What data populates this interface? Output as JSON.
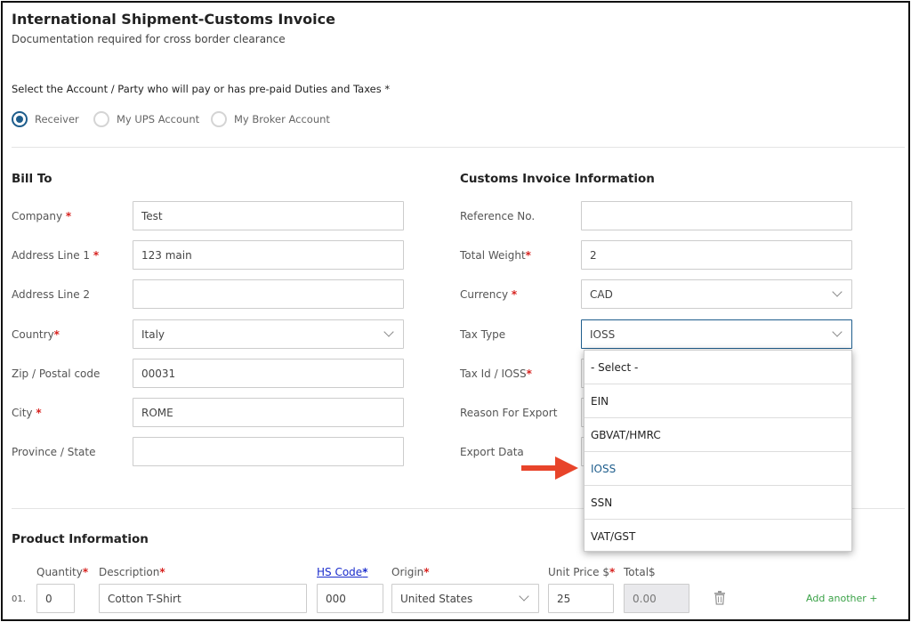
{
  "header": {
    "title": "International Shipment-Customs Invoice",
    "subtitle": "Documentation required for cross border clearance"
  },
  "payer": {
    "label": "Select the Account / Party who will pay or has pre-paid Duties and Taxes *",
    "options": [
      "Receiver",
      "My UPS Account",
      "My Broker Account"
    ],
    "selected": "Receiver"
  },
  "bill_to": {
    "title": "Bill To",
    "fields": [
      {
        "label": "Company",
        "required": "*",
        "value": "Test"
      },
      {
        "label": "Address Line 1",
        "required": "*",
        "value": "123 main"
      },
      {
        "label": "Address Line 2",
        "required": "",
        "value": ""
      },
      {
        "label": "Country",
        "required": "*",
        "value": "Italy"
      },
      {
        "label": "Zip / Postal code",
        "required": "",
        "value": "00031"
      },
      {
        "label": "City",
        "required": "*",
        "value": "ROME"
      },
      {
        "label": "Province / State",
        "required": "",
        "value": ""
      }
    ]
  },
  "customs": {
    "title": "Customs Invoice Information",
    "fields": [
      {
        "label": "Reference No.",
        "required": "",
        "value": ""
      },
      {
        "label": "Total Weight",
        "required": "*",
        "value": "2"
      },
      {
        "label": "Currency",
        "required": "*",
        "value": "CAD"
      },
      {
        "label": "Tax Type",
        "required": "",
        "value": "IOSS"
      },
      {
        "label": "Tax Id / IOSS",
        "required": "*",
        "value": ""
      },
      {
        "label": "Reason For Export",
        "required": "",
        "value": ""
      },
      {
        "label": "Export Data",
        "required": "",
        "value": ""
      }
    ]
  },
  "tax_type_dropdown": {
    "options": [
      "- Select -",
      "EIN",
      "GBVAT/HMRC",
      "IOSS",
      "SSN",
      "VAT/GST"
    ],
    "selected": "IOSS"
  },
  "product": {
    "title": "Product Information",
    "columns": {
      "quantity": "Quantity",
      "description": "Description",
      "hs_code": "HS Code",
      "origin": "Origin",
      "unit_price": "Unit Price $",
      "total": "Total$"
    },
    "rows": [
      {
        "num": "01.",
        "quantity": "0",
        "description": "Cotton T-Shirt",
        "hs_code": "000",
        "origin": "United States",
        "unit_price": "25",
        "total": "0.00"
      }
    ],
    "add_another": "Add another +"
  },
  "colors": {
    "accent": "#1e5d8c",
    "required": "#d7221f",
    "arrow": "#e8442a",
    "add_link": "#3aa247"
  }
}
